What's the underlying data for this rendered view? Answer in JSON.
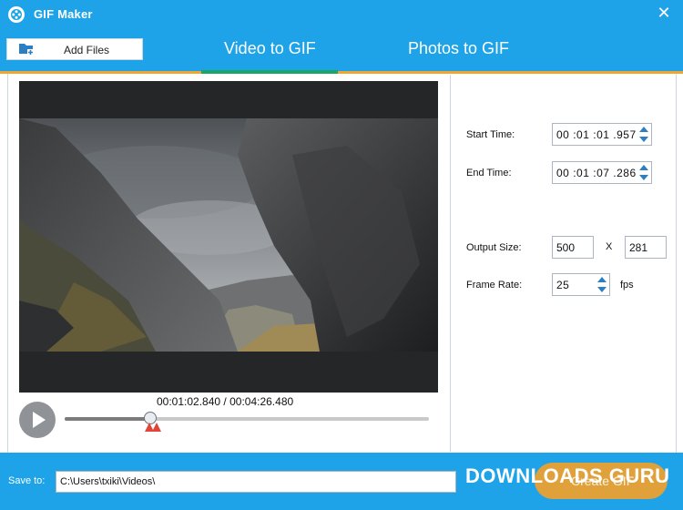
{
  "window": {
    "title": "GIF Maker",
    "app_icon": "film-reel-icon",
    "close_icon": "close-icon",
    "close_glyph": "✕"
  },
  "toolbar": {
    "add_files_label": "Add Files",
    "add_files_icon": "add-folder-icon"
  },
  "tabs": [
    {
      "label": "Video to GIF",
      "active": true
    },
    {
      "label": "Photos to GIF",
      "active": false
    }
  ],
  "player": {
    "current_time": "00:01:02.840",
    "total_time": "00:04:26.480",
    "time_separator": " / ",
    "play_icon": "play-icon",
    "progress_fraction": 0.235
  },
  "settings": {
    "start_time_label": "Start Time:",
    "start_time": {
      "hh": "00",
      "mm": "01",
      "ss": "01",
      "ms": "957"
    },
    "end_time_label": "End Time:",
    "end_time": {
      "hh": "00",
      "mm": "01",
      "ss": "07",
      "ms": "286"
    },
    "output_size_label": "Output Size:",
    "output_width": "500",
    "size_separator": "X",
    "output_height": "281",
    "frame_rate_label": "Frame Rate:",
    "frame_rate": "25",
    "frame_rate_unit": "fps"
  },
  "save": {
    "label": "Save to:",
    "path": "C:\\Users\\txiki\\Videos\\"
  },
  "actions": {
    "create_label": "Create GIF"
  },
  "watermark": {
    "text": "DOWNLOADS GURU"
  },
  "colors": {
    "primary_blue": "#1fa3e8",
    "accent_orange": "#f0a432",
    "active_tab_green": "#1aa56a",
    "spinner_arrow_blue": "#2d7fc1",
    "trim_marker_red": "#e0453a"
  }
}
